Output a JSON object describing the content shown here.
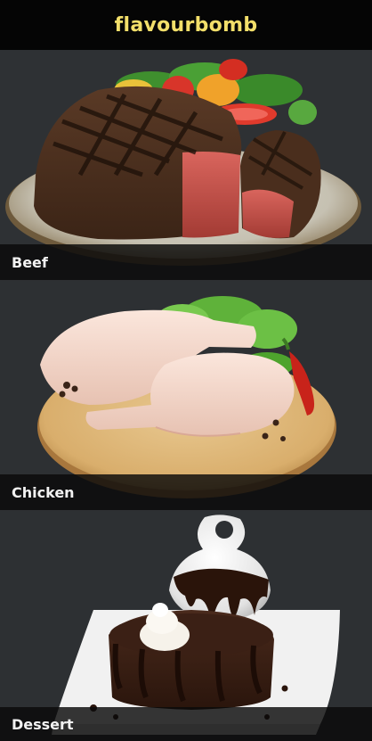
{
  "app": {
    "title": "flavourbomb"
  },
  "categories": [
    {
      "label": "Beef",
      "icon": "beef-steak-photo"
    },
    {
      "label": "Chicken",
      "icon": "chicken-legs-photo"
    },
    {
      "label": "Dessert",
      "icon": "chocolate-cake-photo"
    }
  ],
  "colors": {
    "title": "#f3df6a",
    "header_bg": "#050505",
    "page_bg": "#2a2d30",
    "label_bar": "#0a0a0a"
  }
}
